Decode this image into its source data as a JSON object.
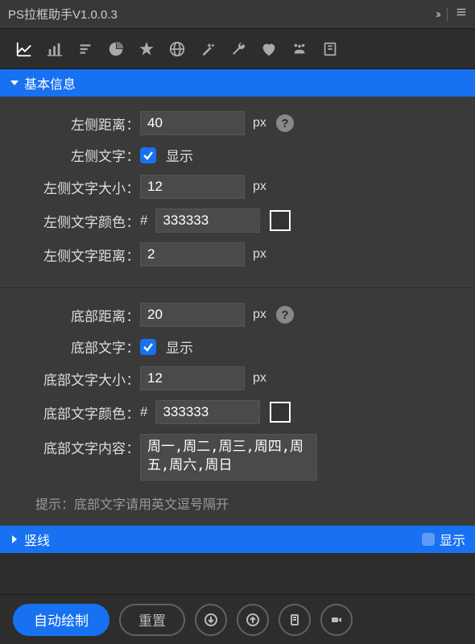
{
  "title": "PS拉框助手V1.0.0.3",
  "sections": {
    "basic": {
      "header": "基本信息",
      "left": {
        "distance_label": "左侧距离",
        "distance_value": "40",
        "distance_unit": "px",
        "text_label": "左侧文字",
        "text_checked": true,
        "text_show": "显示",
        "size_label": "左侧文字大小",
        "size_value": "12",
        "size_unit": "px",
        "color_label": "左侧文字颜色",
        "color_value": "333333",
        "color_swatch": "#333333",
        "gap_label": "左侧文字距离",
        "gap_value": "2",
        "gap_unit": "px"
      },
      "bottom": {
        "distance_label": "底部距离",
        "distance_value": "20",
        "distance_unit": "px",
        "text_label": "底部文字",
        "text_checked": true,
        "text_show": "显示",
        "size_label": "底部文字大小",
        "size_value": "12",
        "size_unit": "px",
        "color_label": "底部文字颜色",
        "color_value": "333333",
        "color_swatch": "#333333",
        "content_label": "底部文字内容",
        "content_value": "周一,周二,周三,周四,周五,周六,周日",
        "hint": "提示：底部文字请用英文逗号隔开"
      }
    },
    "vline": {
      "header": "竖线",
      "toggle_label": "显示"
    }
  },
  "footer": {
    "auto_draw": "自动绘制",
    "reset": "重置"
  },
  "icons": {
    "toolbar": [
      "line-up-chart",
      "bar-chart",
      "list",
      "pie",
      "star",
      "globe",
      "magic",
      "wrench",
      "heart",
      "dog",
      "book"
    ]
  }
}
